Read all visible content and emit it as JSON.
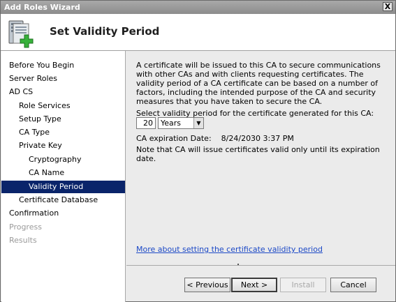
{
  "window": {
    "title": "Add Roles Wizard",
    "close_label": "X"
  },
  "header": {
    "heading": "Set Validity Period",
    "icon": "server-add-icon"
  },
  "nav": {
    "items": [
      {
        "label": "Before You Begin",
        "state": "normal"
      },
      {
        "label": "Server Roles",
        "state": "normal"
      },
      {
        "label": "AD CS",
        "state": "normal"
      },
      {
        "label": "Role Services",
        "state": "normal"
      },
      {
        "label": "Setup Type",
        "state": "normal"
      },
      {
        "label": "CA Type",
        "state": "normal"
      },
      {
        "label": "Private Key",
        "state": "normal"
      },
      {
        "label": "Cryptography",
        "state": "normal"
      },
      {
        "label": "CA Name",
        "state": "normal"
      },
      {
        "label": "Validity Period",
        "state": "selected"
      },
      {
        "label": "Certificate Database",
        "state": "normal"
      },
      {
        "label": "Confirmation",
        "state": "normal"
      },
      {
        "label": "Progress",
        "state": "disabled"
      },
      {
        "label": "Results",
        "state": "disabled"
      }
    ]
  },
  "content": {
    "description": "A certificate will be issued to this CA to secure communications with other CAs and with clients requesting certificates. The validity period of a CA certificate can be based on a number of factors, including the intended purpose of the CA and security measures that you have taken to secure the CA.",
    "select_label": "Select validity period for the certificate generated for this CA:",
    "period_value": "20",
    "unit_selected": "Years",
    "expiration_label": "CA expiration Date:",
    "expiration_value": "8/24/2030 3:37 PM",
    "note": "Note that CA will issue certificates valid only until its expiration date.",
    "more_link": "More about setting the certificate validity period"
  },
  "buttons": {
    "previous": "< Previous",
    "next": "Next >",
    "install": "Install",
    "cancel": "Cancel"
  }
}
